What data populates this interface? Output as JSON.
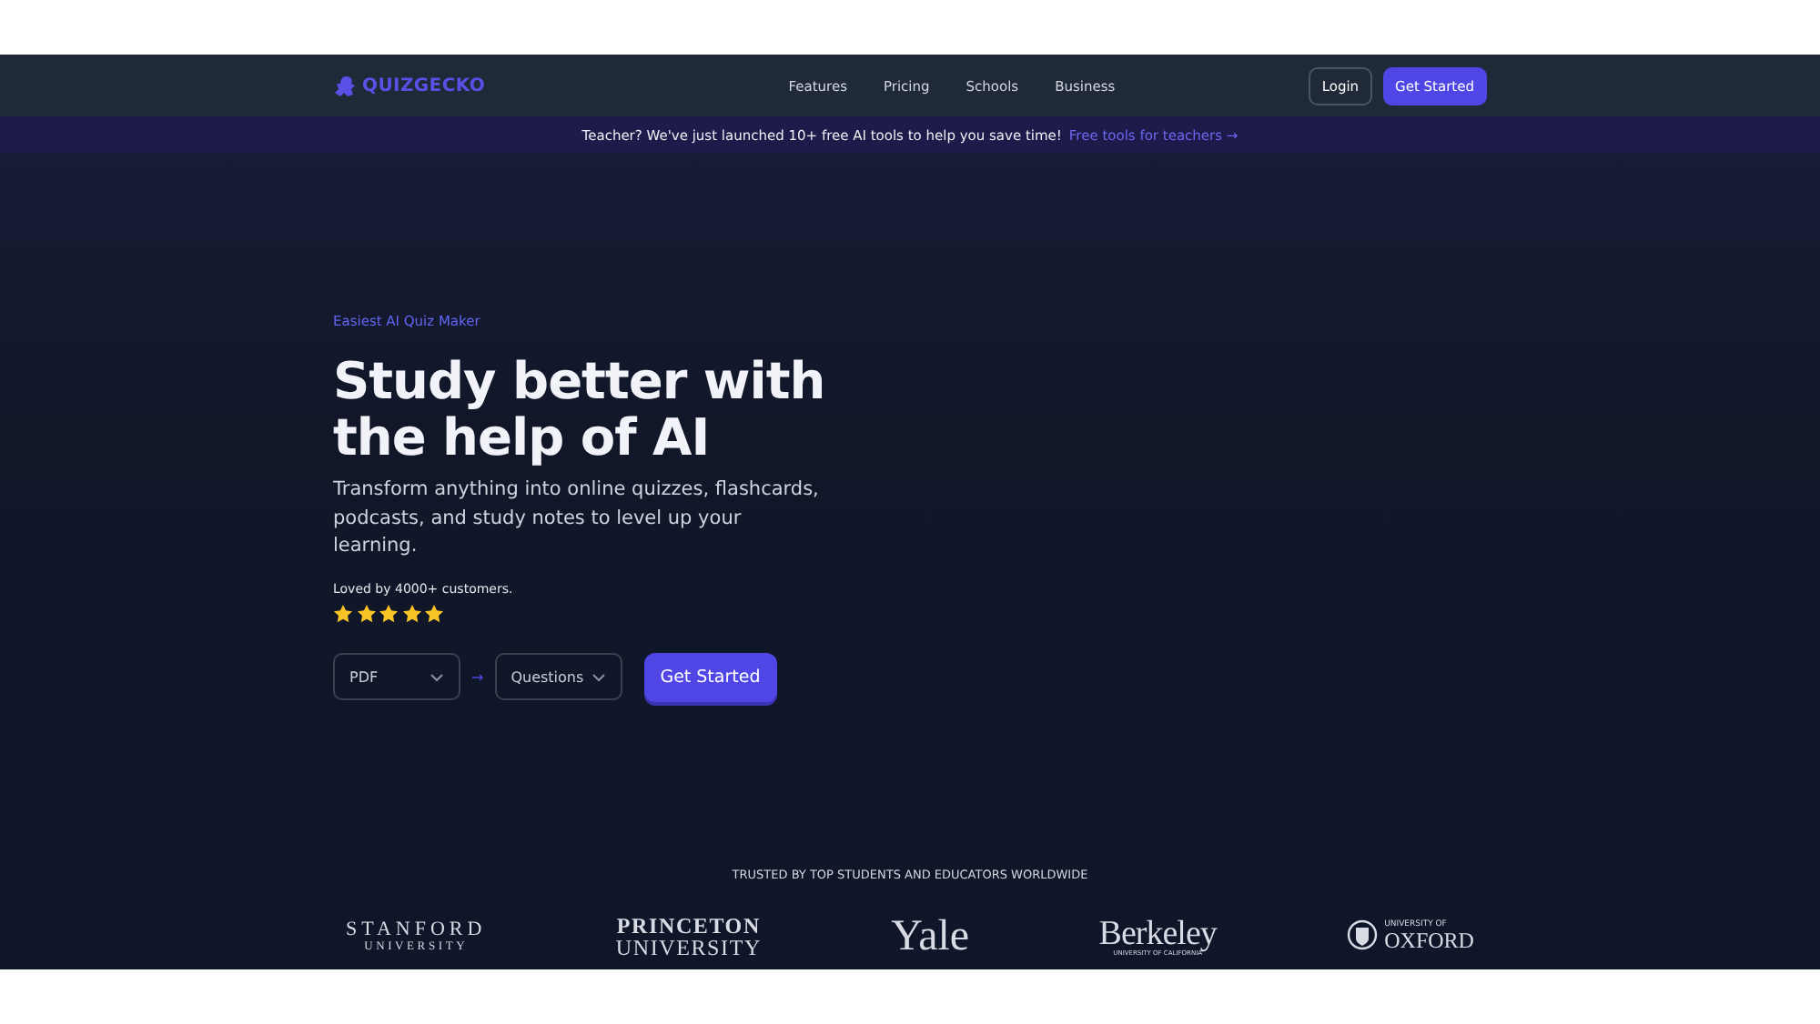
{
  "nav": {
    "logo": "QUIZGECKO",
    "links": [
      "Features",
      "Pricing",
      "Schools",
      "Business"
    ],
    "login": "Login",
    "cta": "Get Started"
  },
  "banner": {
    "text": "Teacher? We've just launched 10+ free AI tools to help you save time!",
    "link": "Free tools for teachers →"
  },
  "hero": {
    "eyebrow": "Easiest AI Quiz Maker",
    "title_lines": [
      "Study better with",
      "the help of AI"
    ],
    "subtitle": "Transform anything into online quizzes, flashcards, podcasts, and study notes to level up your learning.",
    "rating_text": "Loved by 4000+ customers.",
    "stars": 5,
    "source_select": {
      "value": "PDF"
    },
    "arrow": "→",
    "output_select": {
      "value": "Questions"
    },
    "cta": "Get Started"
  },
  "trusted": {
    "heading": "TRUSTED BY TOP STUDENTS AND EDUCATORS WORLDWIDE",
    "logos": [
      {
        "kind": "stacked",
        "main": "STANFORD",
        "sub": "UNIVERSITY"
      },
      {
        "kind": "princeton",
        "main": "PRINCETON",
        "sub": "UNIVERSITY"
      },
      {
        "kind": "single",
        "main": "Yale"
      },
      {
        "kind": "berkeley",
        "main": "Berkeley",
        "sub": "UNIVERSITY OF CALIFORNIA"
      },
      {
        "kind": "crest",
        "main": "OXFORD",
        "sub": "UNIVERSITY OF"
      }
    ]
  }
}
